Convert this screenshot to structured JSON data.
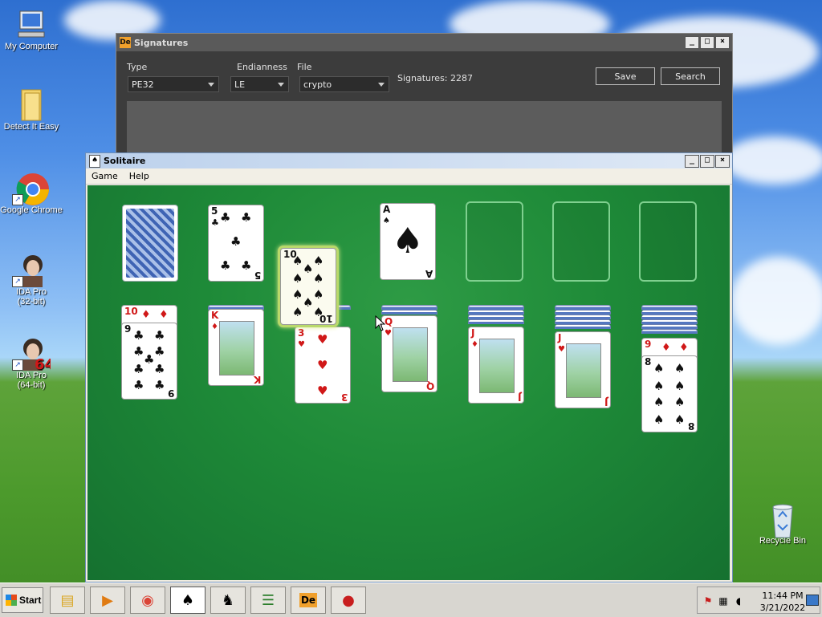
{
  "desktop": {
    "icons": [
      {
        "label": "My Computer"
      },
      {
        "label": "Detect It Easy"
      },
      {
        "label": "Google Chrome"
      },
      {
        "label": "IDA Pro\n(32-bit)"
      },
      {
        "label": "IDA Pro\n(64-bit)"
      },
      {
        "label": "Recycle Bin"
      }
    ]
  },
  "signatures": {
    "title": "Signatures",
    "type_label": "Type",
    "type_value": "PE32",
    "endianness_label": "Endianness",
    "endianness_value": "LE",
    "file_label": "File",
    "file_value": "crypto",
    "count_text": "Signatures: 2287",
    "save_label": "Save",
    "search_label": "Search"
  },
  "solitaire": {
    "title": "Solitaire",
    "menu": [
      "Game",
      "Help"
    ],
    "waste": {
      "rank": "5",
      "suit": "♣",
      "color": "black"
    },
    "dragged": {
      "rank": "10",
      "suit": "♠",
      "color": "black"
    },
    "foundation": [
      {
        "rank": "A",
        "suit": "♠",
        "color": "black"
      }
    ],
    "tableau": [
      {
        "under": "10",
        "under_suit": "♦",
        "top_rank": "9",
        "top_suit": "♣",
        "top_color": "black"
      },
      {
        "top_rank": "K",
        "top_suit": "♦",
        "top_color": "red"
      },
      {
        "top_rank": "3",
        "top_suit": "♥",
        "top_color": "red"
      },
      {
        "top_rank": "Q",
        "top_suit": "♥",
        "top_color": "red"
      },
      {
        "top_rank": "J",
        "top_suit": "♦",
        "top_color": "red"
      },
      {
        "top_rank": "J",
        "top_suit": "♥",
        "top_color": "red"
      },
      {
        "under": "9",
        "under_suit": "♦",
        "top_rank": "8",
        "top_suit": "♠",
        "top_color": "black"
      }
    ]
  },
  "taskbar": {
    "start_label": "Start",
    "time": "11:44 PM",
    "date": "3/21/2022"
  }
}
